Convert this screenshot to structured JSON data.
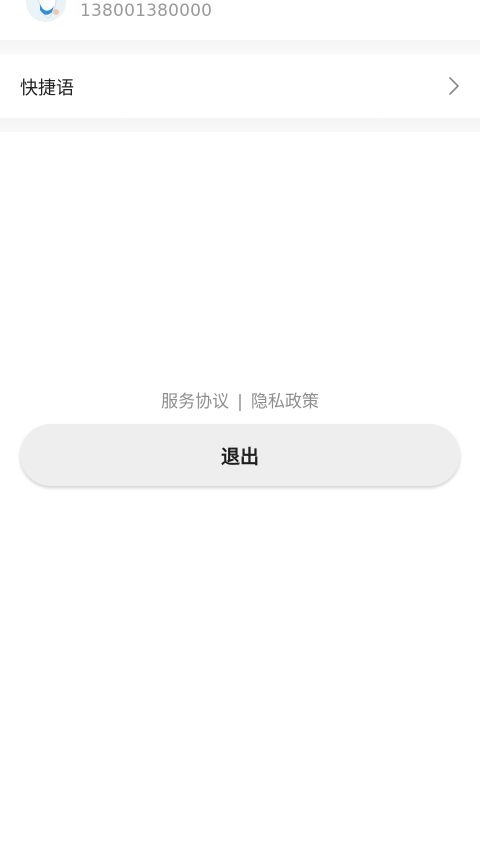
{
  "profile": {
    "phone": "138001380000"
  },
  "menu": {
    "quick_phrases_label": "快捷语"
  },
  "links": {
    "service_agreement": "服务协议",
    "separator": "|",
    "privacy_policy": "隐私政策"
  },
  "actions": {
    "logout_label": "退出"
  },
  "icons": {
    "avatar": "doctor-avatar-icon",
    "chevron": "chevron-right-icon"
  },
  "colors": {
    "page_background": "#ffffff",
    "section_gap": "#f5f5f5",
    "button_background": "#eeeeee",
    "muted_text": "#8e8e8e",
    "primary_text": "#222222"
  }
}
